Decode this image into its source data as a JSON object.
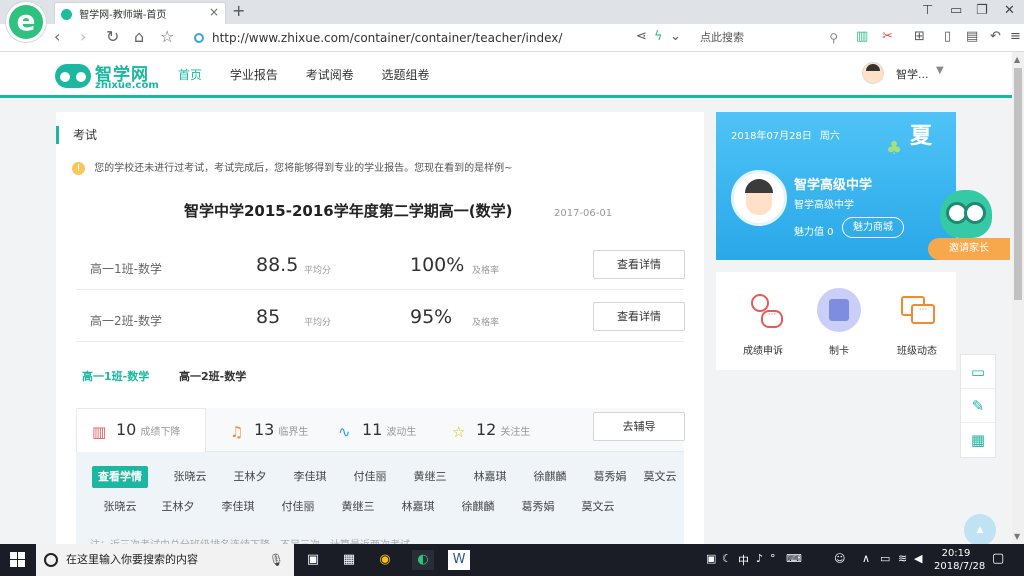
{
  "browser": {
    "tab_title": "智学网-教师端-首页",
    "tab_close": "×",
    "new_tab": "+",
    "url": "http://www.zhixue.com/container/container/teacher/index/",
    "search_placeholder": "点此搜索"
  },
  "site": {
    "logo_name": "智学网",
    "logo_domain": "zhixue.com",
    "nav": [
      "首页",
      "学业报告",
      "考试阅卷",
      "选题组卷"
    ],
    "active_nav": "首页",
    "user_name": "智学..."
  },
  "main": {
    "section_title": "考试",
    "notice": "您的学校还未进行过考试，考试完成后，您将能够得到专业的学业报告。您现在看到的是样例~",
    "exam_title": "智学中学2015-2016学年度第二学期高一(数学)",
    "exam_date": "2017-06-01",
    "avg_label": "平均分",
    "pass_label": "及格率",
    "detail_button": "查看详情",
    "classes": [
      {
        "name": "高一1班-数学",
        "avg": "88.5",
        "pass": "100%"
      },
      {
        "name": "高一2班-数学",
        "avg": "85",
        "pass": "95%"
      }
    ],
    "class_tabs": [
      "高一1班-数学",
      "高一2班-数学"
    ],
    "stats": [
      {
        "num": "10",
        "label": "成绩下降",
        "icon": "bar-decline-icon"
      },
      {
        "num": "13",
        "label": "临界生",
        "icon": "bell-icon"
      },
      {
        "num": "11",
        "label": "波动生",
        "icon": "wave-icon"
      },
      {
        "num": "12",
        "label": "关注生",
        "icon": "star-icon"
      }
    ],
    "tutor_button": "去辅导",
    "view_analysis": "查看学情",
    "names_row1": [
      "张晓云",
      "王林夕",
      "李佳琪",
      "付佳丽",
      "黄继三",
      "林嘉琪",
      "徐麒麟",
      "葛秀娟",
      "莫文云"
    ],
    "names_row2": [
      "张晓云",
      "王林夕",
      "李佳琪",
      "付佳丽",
      "黄继三",
      "林嘉琪",
      "徐麒麟",
      "葛秀娟",
      "莫文云"
    ],
    "footnote": "注：近三次考试中总分班级排名连续下降，不足三次，计算最近两次考试"
  },
  "profile": {
    "date": "2018年07月28日",
    "weekday": "周六",
    "season": "夏",
    "school": "智学高级中学",
    "school_sub": "智学高级中学",
    "charm": "魅力值 0",
    "mall_button": "魅力商城",
    "invite_button": "邀请家长"
  },
  "quick": [
    {
      "label": "成绩申诉",
      "icon": "appeal-icon"
    },
    {
      "label": "制卡",
      "icon": "card-icon"
    },
    {
      "label": "班级动态",
      "icon": "chat-icon"
    }
  ],
  "taskbar": {
    "search_placeholder": "在这里输入你要搜索的内容",
    "ime": "中",
    "time": "20:19",
    "date": "2018/7/28"
  },
  "colors": {
    "brand": "#1cb7a1",
    "profile_bg": "#29a8e8",
    "invite": "#f7a84d"
  }
}
